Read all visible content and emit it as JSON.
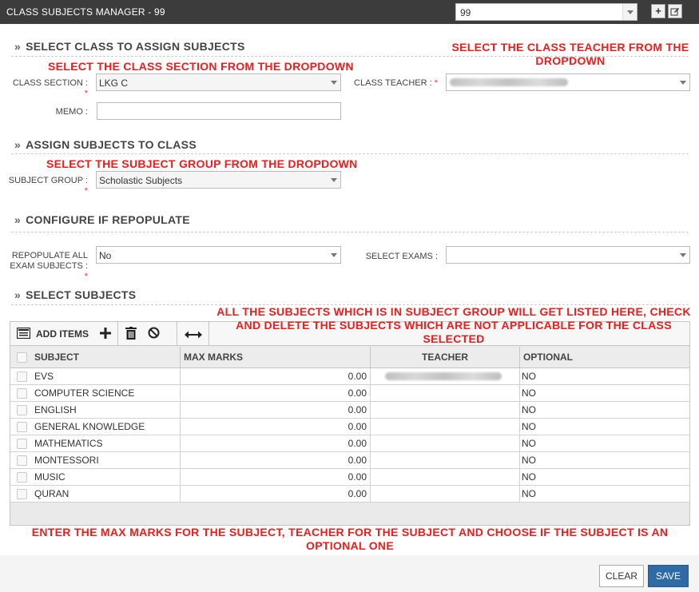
{
  "window": {
    "title": "CLASS SUBJECTS MANAGER - 99",
    "record_combo": "99"
  },
  "sections": {
    "select_class": "SELECT CLASS TO ASSIGN SUBJECTS",
    "assign_subjects": "ASSIGN SUBJECTS TO CLASS",
    "repopulate": "CONFIGURE IF REPOPULATE",
    "select_subjects": "SELECT SUBJECTS"
  },
  "annotations": {
    "class_section": "SELECT THE CLASS SECTION FROM THE DROPDOWN",
    "class_teacher": "SELECT THE CLASS TEACHER FROM THE DROPDOWN",
    "subject_group": "SELECT THE SUBJECT GROUP FROM THE DROPDOWN",
    "subjects_list": "ALL THE SUBJECTS WHICH IS IN SUBJECT GROUP WILL GET LISTED HERE, CHECK AND DELETE THE SUBJECTS WHICH ARE NOT APPLICABLE FOR THE CLASS SELECTED",
    "max_marks": "ENTER THE MAX MARKS FOR THE SUBJECT, TEACHER FOR THE SUBJECT AND CHOOSE IF THE SUBJECT IS AN OPTIONAL ONE"
  },
  "form": {
    "class_section": {
      "label": "CLASS SECTION :",
      "required": "*",
      "value": "LKG C"
    },
    "class_teacher": {
      "label": "CLASS TEACHER :",
      "required": "*"
    },
    "memo": {
      "label": "MEMO :",
      "value": ""
    },
    "subject_group": {
      "label": "SUBJECT GROUP :",
      "required": "*",
      "value": "Scholastic Subjects"
    },
    "repopulate": {
      "label_line1": "REPOPULATE ALL",
      "label_line2": "EXAM SUBJECTS :",
      "required": "*",
      "value": "No"
    },
    "select_exams": {
      "label": "SELECT EXAMS :",
      "value": ""
    }
  },
  "grid": {
    "toolbar": {
      "add_items_label": "ADD ITEMS"
    },
    "columns": {
      "subject": "SUBJECT",
      "max_marks": "MAX MARKS",
      "teacher": "TEACHER",
      "optional": "OPTIONAL"
    },
    "rows": [
      {
        "subject": "EVS",
        "max_marks": "0.00",
        "optional": "NO",
        "teacher_blurred": true
      },
      {
        "subject": "COMPUTER SCIENCE",
        "max_marks": "0.00",
        "optional": "NO"
      },
      {
        "subject": "ENGLISH",
        "max_marks": "0.00",
        "optional": "NO"
      },
      {
        "subject": "GENERAL KNOWLEDGE",
        "max_marks": "0.00",
        "optional": "NO"
      },
      {
        "subject": "MATHEMATICS",
        "max_marks": "0.00",
        "optional": "NO"
      },
      {
        "subject": "MONTESSORI",
        "max_marks": "0.00",
        "optional": "NO"
      },
      {
        "subject": "MUSIC",
        "max_marks": "0.00",
        "optional": "NO"
      },
      {
        "subject": "QURAN",
        "max_marks": "0.00",
        "optional": "NO"
      }
    ]
  },
  "footer": {
    "clear_label": "CLEAR",
    "save_label": "SAVE"
  },
  "colors": {
    "annotation": "#ee1c1c",
    "titlebar": "#3c3c3c",
    "save_button": "#2e6aa6"
  }
}
